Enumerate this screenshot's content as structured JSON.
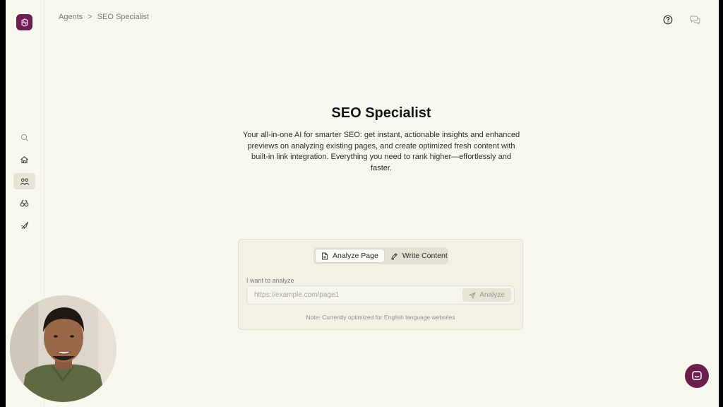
{
  "breadcrumb": {
    "root": "Agents",
    "separator": ">",
    "current": "SEO Specialist"
  },
  "sidebar": {
    "items": [
      {
        "icon": "search-icon"
      },
      {
        "icon": "home-icon"
      },
      {
        "icon": "agents-icon",
        "active": true
      },
      {
        "icon": "binoculars-icon"
      },
      {
        "icon": "rocket-icon"
      }
    ]
  },
  "hero": {
    "title": "SEO Specialist",
    "description": "Your all-in-one AI for smarter SEO: get instant, actionable insights and enhanced previews on analyzing existing pages, and create optimized fresh content with built-in link integration. Everything you need to rank higher—effortlessly and faster."
  },
  "tabs": {
    "analyze": "Analyze Page",
    "write": "Write Content",
    "active": "analyze"
  },
  "form": {
    "label": "I want to analyze",
    "placeholder": "https://example.com/page1",
    "button": "Analyze",
    "note": "Note: Currently optimized for English language websites"
  },
  "colors": {
    "background": "#f9f8ef",
    "brand": "#6e1f52",
    "card": "#f3f1e6"
  }
}
